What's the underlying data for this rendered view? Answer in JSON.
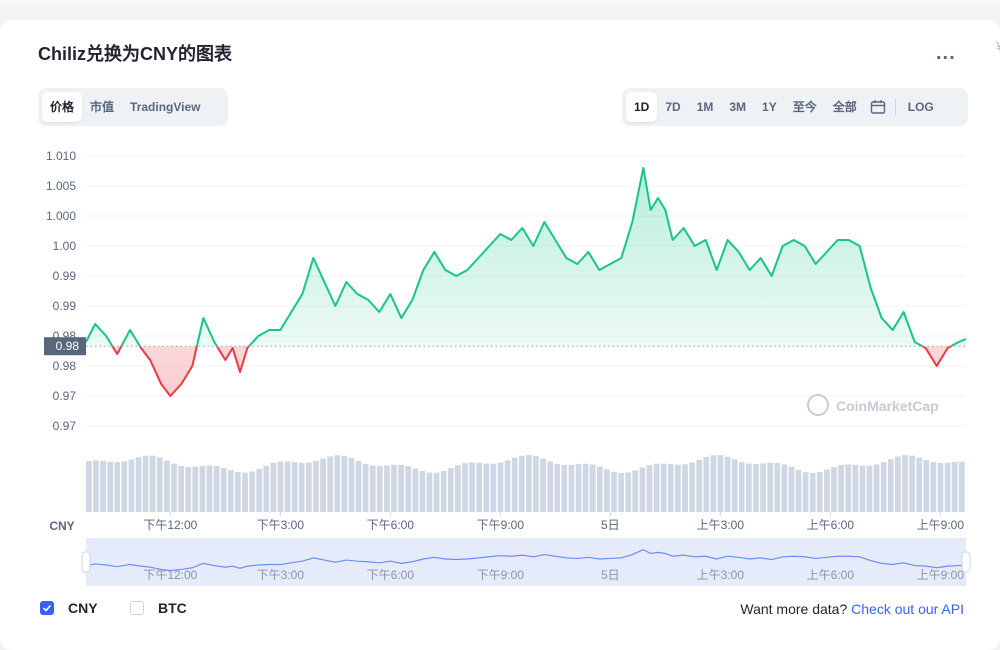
{
  "header": {
    "title": "Chiliz兑换为CNY的图表",
    "more_label": "..."
  },
  "view_tabs": [
    "价格",
    "市值",
    "TradingView"
  ],
  "range_tabs": [
    "1D",
    "7D",
    "1M",
    "3M",
    "1Y",
    "至今",
    "全部"
  ],
  "log_label": "LOG",
  "legend": {
    "cny": "CNY",
    "btc": "BTC"
  },
  "footer": {
    "text": "Want more data?",
    "link": "Check out our API"
  },
  "watermark": "CoinMarketCap",
  "colors": {
    "up": "#16c784",
    "down": "#ea3943",
    "accent": "#3861fb",
    "volume": "#cfd6e4"
  },
  "chart_data": {
    "type": "line",
    "y_axis_label": "CNY",
    "y_ticks": [
      "1.010",
      "1.005",
      "1.000",
      "1.00",
      "0.99",
      "0.99",
      "0.98",
      "0.98",
      "0.97",
      "0.97"
    ],
    "y_tick_values": [
      1.01,
      1.005,
      1.0,
      0.995,
      0.99,
      0.985,
      0.98,
      0.975,
      0.97,
      0.965
    ],
    "ylim": [
      0.96,
      1.011
    ],
    "x_ticks": [
      "下午12:00",
      "下午3:00",
      "下午6:00",
      "下午9:00",
      "5日",
      "上午3:00",
      "上午6:00",
      "上午9:00"
    ],
    "x_tick_hours": [
      2.3,
      5.3,
      8.3,
      11.3,
      14.3,
      17.3,
      20.3,
      23.3
    ],
    "x_range_hours": [
      0,
      24
    ],
    "reference_price": 0.9783,
    "reference_label": "0.98",
    "series": [
      {
        "x": [
          0,
          0.25,
          0.55,
          0.85,
          1.2,
          1.5,
          1.75,
          2.05,
          2.3,
          2.6,
          2.9,
          3.2,
          3.5,
          3.8,
          4.0,
          4.2,
          4.4,
          4.7,
          5.0,
          5.3,
          5.6,
          5.9,
          6.2,
          6.5,
          6.8,
          7.1,
          7.4,
          7.7,
          8.0,
          8.3,
          8.6,
          8.9,
          9.2,
          9.5,
          9.8,
          10.1,
          10.4,
          10.7,
          11.0,
          11.3,
          11.6,
          11.9,
          12.2,
          12.5,
          12.8,
          13.1,
          13.4,
          13.7,
          14.0,
          14.3,
          14.6,
          14.9,
          15.2,
          15.4,
          15.6,
          15.8,
          16.0,
          16.3,
          16.6,
          16.9,
          17.2,
          17.5,
          17.8,
          18.1,
          18.4,
          18.7,
          19.0,
          19.3,
          19.6,
          19.9,
          20.2,
          20.5,
          20.8,
          21.1,
          21.4,
          21.7,
          22.0,
          22.3,
          22.6,
          22.9,
          23.2,
          23.5,
          23.8,
          24.0
        ],
        "y": [
          0.979,
          0.982,
          0.98,
          0.977,
          0.981,
          0.978,
          0.976,
          0.972,
          0.97,
          0.972,
          0.975,
          0.983,
          0.979,
          0.976,
          0.978,
          0.974,
          0.978,
          0.98,
          0.981,
          0.981,
          0.984,
          0.987,
          0.993,
          0.989,
          0.985,
          0.989,
          0.987,
          0.986,
          0.984,
          0.987,
          0.983,
          0.986,
          0.991,
          0.994,
          0.991,
          0.99,
          0.991,
          0.993,
          0.995,
          0.997,
          0.996,
          0.998,
          0.995,
          0.999,
          0.996,
          0.993,
          0.992,
          0.994,
          0.991,
          0.992,
          0.993,
          0.999,
          1.008,
          1.001,
          1.003,
          1.001,
          0.996,
          0.998,
          0.995,
          0.996,
          0.991,
          0.996,
          0.994,
          0.991,
          0.993,
          0.99,
          0.995,
          0.996,
          0.995,
          0.992,
          0.994,
          0.996,
          0.996,
          0.995,
          0.988,
          0.983,
          0.981,
          0.984,
          0.979,
          0.978,
          0.975,
          0.978,
          0.979,
          0.9795
        ]
      }
    ]
  }
}
